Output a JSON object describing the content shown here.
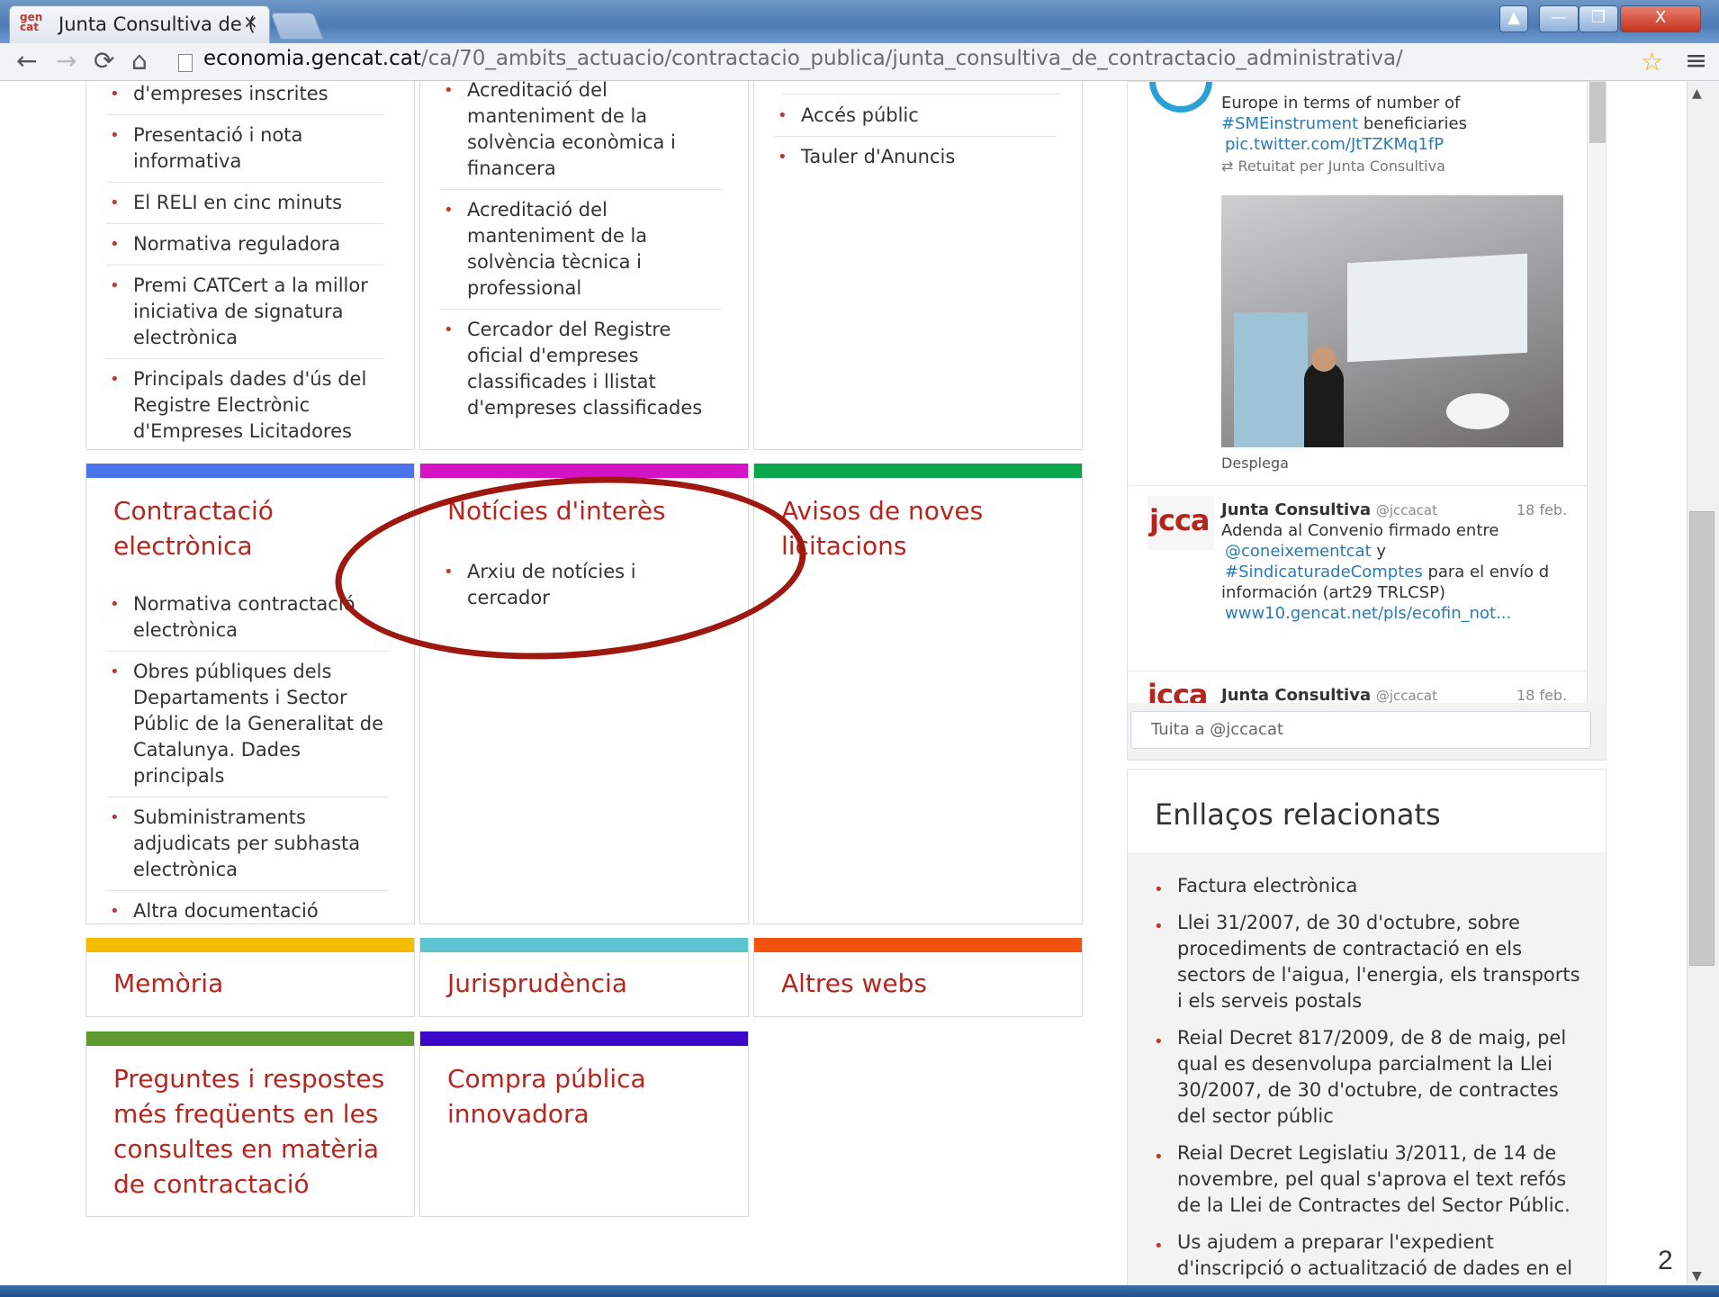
{
  "browser": {
    "tab_title": "Junta Consultiva de (",
    "tab_favicon": "gen cat",
    "tab_close": "×",
    "url_host": "economia.gencat.cat",
    "url_path": "/ca/70_ambits_actuacio/contractacio_publica/junta_consultiva_de_contractacio_administrativa/",
    "window_buttons": [
      "▲",
      "—",
      "❐",
      "X"
    ]
  },
  "top_cards": {
    "col1": [
      "d'empreses inscrites",
      "Presentació i nota informativa",
      "El RELI en cinc minuts",
      "Normativa reguladora",
      "Premi CATCert a la millor iniciativa de signatura electrònica",
      "Principals dades d'ús del Registre Electrònic d'Empreses Licitadores"
    ],
    "col2": [
      "Acreditació del manteniment de la solvència econòmica i financera",
      "Acreditació del manteniment de la solvència tècnica i professional",
      "Cercador del Registre oficial d'empreses classificades i llistat d'empreses classificades"
    ],
    "col3": [
      "Accés públic",
      "Tauler d'Anuncis"
    ]
  },
  "sections": {
    "contractacio": {
      "title": "Contractació electrònica",
      "color": "#4a74e8",
      "items": [
        "Normativa contractació electrònica",
        "Obres públiques dels Departaments i Sector Públic de la Generalitat de Catalunya. Dades principals",
        "Subministraments adjudicats per subhasta electrònica",
        "Altra documentació"
      ]
    },
    "noticies": {
      "title": "Notícies d'interès",
      "color": "#d414c4",
      "items": [
        "Arxiu de notícies i cercador"
      ]
    },
    "avisos": {
      "title": "Avisos de noves licitacions",
      "color": "#0aa64b"
    },
    "memoria": {
      "title": "Memòria",
      "color": "#f5bd00"
    },
    "jurisprudencia": {
      "title": "Jurisprudència",
      "color": "#5bc4d0"
    },
    "altres": {
      "title": "Altres webs",
      "color": "#f4530f"
    },
    "preguntes": {
      "title": "Preguntes i respostes més freqüents en les consultes en matèria de contractació",
      "color": "#5f9a2f"
    },
    "compra": {
      "title": "Compra pública innovadora",
      "color": "#3b07c9"
    }
  },
  "twitter": {
    "tweet1_text": "Europe in terms of number of",
    "tweet1_hashtag": "#SMEinstrument",
    "tweet1_text2": "beneficiaries",
    "tweet1_link": "pic.twitter.com/JtTZKMq1fP",
    "tweet1_retweet": "Retuitat per Junta Consultiva",
    "tweet1_expand": "Desplega",
    "tweet2_logo": "jcca",
    "tweet2_name": "Junta Consultiva",
    "tweet2_handle": "@jccacat",
    "tweet2_date": "18 feb.",
    "tweet2_text": "Adenda al Convenio firmado entre",
    "tweet2_mention": "@coneixementcat",
    "tweet2_y": "y",
    "tweet2_hashtag": "#SindicaturadeComptes",
    "tweet2_text2": "para el envío d",
    "tweet2_text3": "información (art29 TRLCSP)",
    "tweet2_link": "www10.gencat.net/pls/ecofin_not...",
    "tweet3_logo": "jcca",
    "tweet3_name": "Junta Consultiva",
    "tweet3_handle": "@jccacat",
    "tweet3_date": "18 feb.",
    "tweet_box_placeholder": "Tuita a @jccacat"
  },
  "related": {
    "title": "Enllaços relacionats",
    "items": [
      "Factura electrònica",
      "Llei 31/2007, de 30 d'octubre, sobre procediments de contractació en els sectors de l'aigua, l'energia, els transports i els serveis postals",
      "Reial Decret 817/2009, de 8 de maig, pel qual es desenvolupa parcialment la Llei 30/2007, de 30 d'octubre, de contractes del sector públic",
      "Reial Decret Legislatiu 3/2011, de 14 de novembre, pel qual s'aprova el text refós de la Llei de Contractes del Sector Públic.",
      "Us ajudem a preparar l'expedient d'inscripció o actualització de dades en el"
    ]
  },
  "page_number": "2"
}
